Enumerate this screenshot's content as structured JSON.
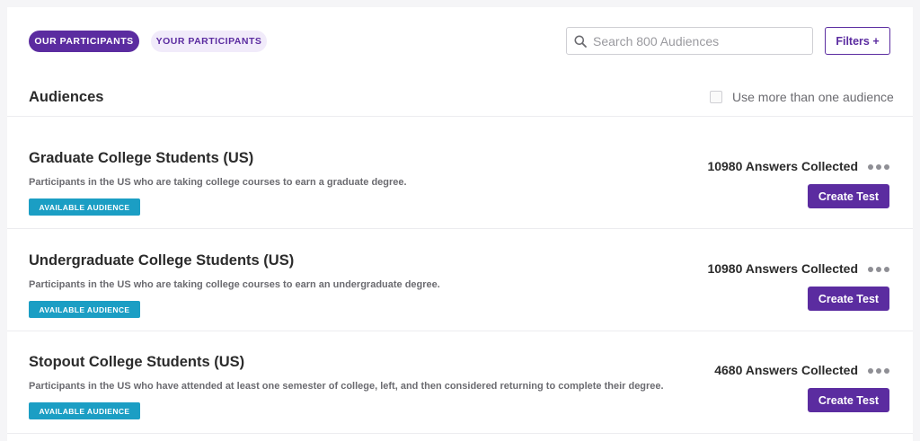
{
  "tabs": {
    "ours": "OUR PARTICIPANTS",
    "yours": "YOUR PARTICIPANTS"
  },
  "search": {
    "placeholder": "Search 800 Audiences",
    "value": ""
  },
  "filters_label": "Filters +",
  "section_title": "Audiences",
  "multi_audience_label": "Use more than one audience",
  "audiences": [
    {
      "title": "Graduate College Students (US)",
      "description": "Participants in the US who are taking college courses to earn a graduate degree.",
      "badge": "AVAILABLE AUDIENCE",
      "answers": "10980 Answers Collected",
      "button": "Create Test"
    },
    {
      "title": "Undergraduate College Students (US)",
      "description": "Participants in the US who are taking college courses to earn an undergraduate degree.",
      "badge": "AVAILABLE AUDIENCE",
      "answers": "10980 Answers Collected",
      "button": "Create Test"
    },
    {
      "title": "Stopout College Students (US)",
      "description": "Participants in the US who have attended at least one semester of college, left, and then considered returning to complete their degree.",
      "badge": "AVAILABLE AUDIENCE",
      "answers": "4680 Answers Collected",
      "button": "Create Test"
    }
  ],
  "colors": {
    "brand_purple": "#5b2ca0",
    "badge_blue": "#1b9ec4",
    "light_purple": "#f1ebfa"
  },
  "icons": {
    "search": "search-icon",
    "more": "more-options-icon"
  }
}
